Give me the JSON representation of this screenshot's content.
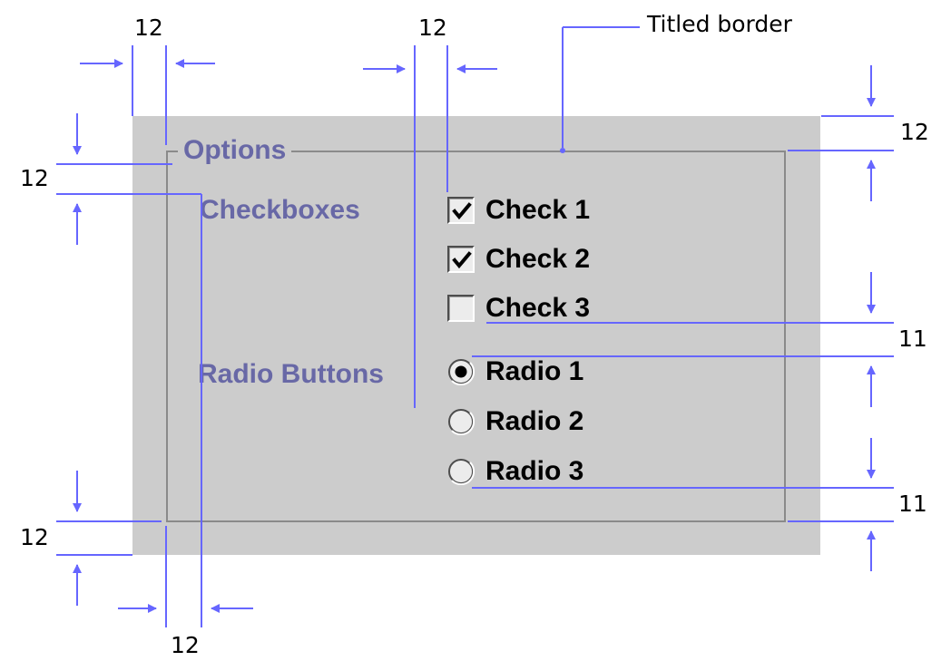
{
  "panel": {
    "title": "Options",
    "checkbox_group": {
      "label": "Checkboxes",
      "items": [
        {
          "label": "Check 1",
          "checked": true
        },
        {
          "label": "Check 2",
          "checked": true
        },
        {
          "label": "Check 3",
          "checked": false
        }
      ]
    },
    "radio_group": {
      "label": "Radio Buttons",
      "items": [
        {
          "label": "Radio 1",
          "selected": true
        },
        {
          "label": "Radio 2",
          "selected": false
        },
        {
          "label": "Radio 3",
          "selected": false
        }
      ]
    }
  },
  "annotations": {
    "titled_border_label": "Titled border",
    "spacing_top_left_h": "12",
    "spacing_top_middle_h": "12",
    "spacing_top_right_v": "12",
    "spacing_left_v": "12",
    "spacing_after_checkboxes_v": "11",
    "spacing_after_radios_v": "11",
    "spacing_bottom_left_v": "12",
    "spacing_bottom_h": "12"
  },
  "colors": {
    "panel_background": "#cccccc",
    "border_title_text": "#6868a6",
    "annotation_line": "#6666ff",
    "border_line": "#8a8a8a"
  }
}
